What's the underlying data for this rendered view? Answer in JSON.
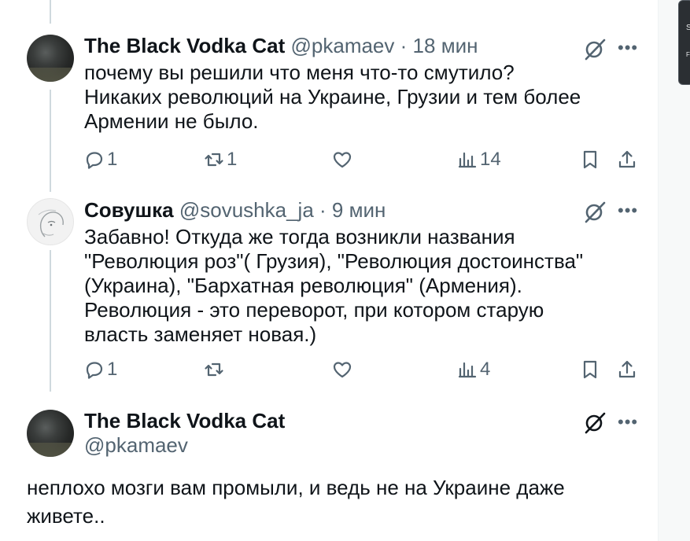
{
  "tweets": [
    {
      "name": "The Black Vodka Cat",
      "handle": "@pkamaev",
      "dot": "·",
      "time": "18 мин",
      "lines": [
        "почему вы решили что меня что-то смутило?",
        "Никаких революций на Украине, Грузии и тем более",
        "Армении не было."
      ],
      "replies": "1",
      "reposts": "1",
      "likes": "",
      "views": "14"
    },
    {
      "name": "Совушка",
      "handle": "@sovushka_ja",
      "dot": "·",
      "time": "9 мин",
      "lines": [
        "Забавно! Откуда же тогда возникли названия",
        "\"Революция роз\"( Грузия), \"Революция достоинства\"",
        "(Украина), \"Бархатная революция\" (Армения).",
        "Революция - это переворот, при котором старую",
        "власть заменяет новая.)"
      ],
      "replies": "1",
      "reposts": "",
      "likes": "",
      "views": "4"
    }
  ],
  "main_tweet": {
    "name": "The Black Vodka Cat",
    "handle": "@pkamaev",
    "lines": [
      "неплохо мозги вам промыли, и ведь не на Украине даже",
      "живете.."
    ]
  },
  "popup": {
    "line1": "S",
    "line2": "F"
  },
  "icons": {
    "grok": "grok-icon",
    "more": "more-icon",
    "reply": "reply-icon",
    "repost": "repost-icon",
    "like": "like-icon",
    "views": "views-icon",
    "bookmark": "bookmark-icon",
    "share": "share-icon"
  },
  "colors": {
    "text": "#0f1419",
    "secondary": "#536471",
    "thread_line": "#cfd9de"
  }
}
